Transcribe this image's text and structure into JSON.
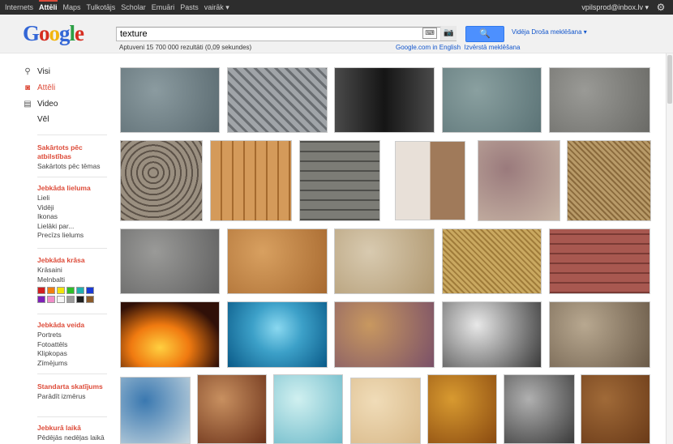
{
  "topbar": {
    "items": [
      "Internets",
      "Attēli",
      "Maps",
      "Tulkotājs",
      "Scholar",
      "Emuāri",
      "Pasts",
      "vairāk ▾"
    ],
    "active_index": 1,
    "user": "vpilsprod@inbox.lv ▾"
  },
  "logo": "Google",
  "search": {
    "value": "texture",
    "button_label": "🔍",
    "safe_search": "Vidēja Droša meklēšana ▾"
  },
  "stats": "Aptuveni 15 700 000 rezultāti (0,09 sekundes)",
  "links": {
    "english": "Google.com in English",
    "advanced": "Izvērstā meklēšana"
  },
  "sidebar": {
    "modes": [
      {
        "icon": "search-icon",
        "label": "Visi"
      },
      {
        "icon": "camera-icon",
        "label": "Attēli"
      },
      {
        "icon": "film-icon",
        "label": "Video"
      },
      {
        "icon": "",
        "label": "Vēl"
      }
    ],
    "sections": [
      {
        "title": "Sakārtots pēc atbilstības",
        "items": [
          "Sakārtots pēc tēmas"
        ]
      },
      {
        "title": "Jebkāda lieluma",
        "items": [
          "Lieli",
          "Vidēji",
          "Ikonas",
          "Lielāki par...",
          "Precīzs lielums"
        ]
      },
      {
        "title": "Jebkāda krāsa",
        "items": [
          "Krāsaini",
          "Melnbalti"
        ]
      },
      {
        "title": "Jebkāda veida",
        "items": [
          "Portrets",
          "Fotoattēls",
          "Klipkopas",
          "Zīmējums"
        ]
      },
      {
        "title": "Standarta skatījums",
        "items": [
          "Parādīt izmērus"
        ]
      },
      {
        "title": "Jebkurā laikā",
        "items": [
          "Pēdējās nedēļas laikā"
        ]
      }
    ],
    "colors": [
      "#d21f1f",
      "#f07f10",
      "#f2e30c",
      "#2fbf29",
      "#22b0b0",
      "#1a3ad6",
      "#7e1fb8",
      "#f08bc8",
      "#f5f5f5",
      "#9a9a9a",
      "#202020",
      "#8a5a2a"
    ]
  },
  "images": [
    {
      "name": "ornate-metal-texture",
      "bg": "#8b9ba0",
      "bg2": "#5a6a70"
    },
    {
      "name": "diamond-plate-texture",
      "bg": "#a0a4a8",
      "bg2": "#6a6e72"
    },
    {
      "name": "brushed-black-metal-texture",
      "bg": "#4a4a4a",
      "bg2": "#151515"
    },
    {
      "name": "stone-wall-texture",
      "bg": "#8aa0a0",
      "bg2": "#5b7376"
    },
    {
      "name": "rough-rock-texture",
      "bg": "#9a9a96",
      "bg2": "#6a6a66"
    },
    {
      "name": "wood-rings-texture",
      "bg": "#9a8f80",
      "bg2": "#5c5248"
    },
    {
      "name": "parquet-floor-texture",
      "bg": "#d49a5a",
      "bg2": "#a56a2e"
    },
    {
      "name": "stone-brick-texture",
      "bg": "#7c7c76",
      "bg2": "#4e4e4a"
    },
    {
      "name": "texture-collage",
      "bg": "#e8e0d8",
      "bg2": "#a07a5a"
    },
    {
      "name": "retro-pattern-texture",
      "bg": "#9a7a7c",
      "bg2": "#c9b6a6"
    },
    {
      "name": "woven-straw-texture",
      "bg": "#b89a68",
      "bg2": "#8a6a3c"
    },
    {
      "name": "concrete-texture",
      "bg": "#9a9a98",
      "bg2": "#606060"
    },
    {
      "name": "crumpled-paper-texture",
      "bg": "#d8a060",
      "bg2": "#a86a30"
    },
    {
      "name": "parchment-texture",
      "bg": "#d8cab0",
      "bg2": "#b09870"
    },
    {
      "name": "woven-fabric-texture",
      "bg": "#c9a860",
      "bg2": "#a07c3a"
    },
    {
      "name": "red-brick-texture",
      "bg": "#a85850",
      "bg2": "#7a3a34"
    },
    {
      "name": "fire-texture",
      "bg": "#f07a10",
      "bg2": "#301008"
    },
    {
      "name": "water-texture",
      "bg": "#3ca0c8",
      "bg2": "#0a5a88"
    },
    {
      "name": "grunge-paper-texture",
      "bg": "#c89860",
      "bg2": "#7a5068"
    },
    {
      "name": "grunge-swirl-texture",
      "bg": "#e8e8e8",
      "bg2": "#3a3a3a"
    },
    {
      "name": "cracked-ground-texture",
      "bg": "#b8a890",
      "bg2": "#6a5a48"
    },
    {
      "name": "blue-grunge-texture",
      "bg": "#3a78b0",
      "bg2": "#c8d8e0"
    },
    {
      "name": "old-music-sheet-texture",
      "bg": "#c89060",
      "bg2": "#6a3018"
    },
    {
      "name": "light-teal-texture",
      "bg": "#d0f0f0",
      "bg2": "#6ab8c8"
    },
    {
      "name": "plain-paper-texture",
      "bg": "#f0dcb8",
      "bg2": "#d8b888"
    },
    {
      "name": "golden-grunge-texture",
      "bg": "#d89a30",
      "bg2": "#8a4a10"
    },
    {
      "name": "grey-grunge-texture",
      "bg": "#b0b0b0",
      "bg2": "#3a3a3a"
    },
    {
      "name": "burlap-texture",
      "bg": "#a06a38",
      "bg2": "#6a3a18"
    }
  ]
}
